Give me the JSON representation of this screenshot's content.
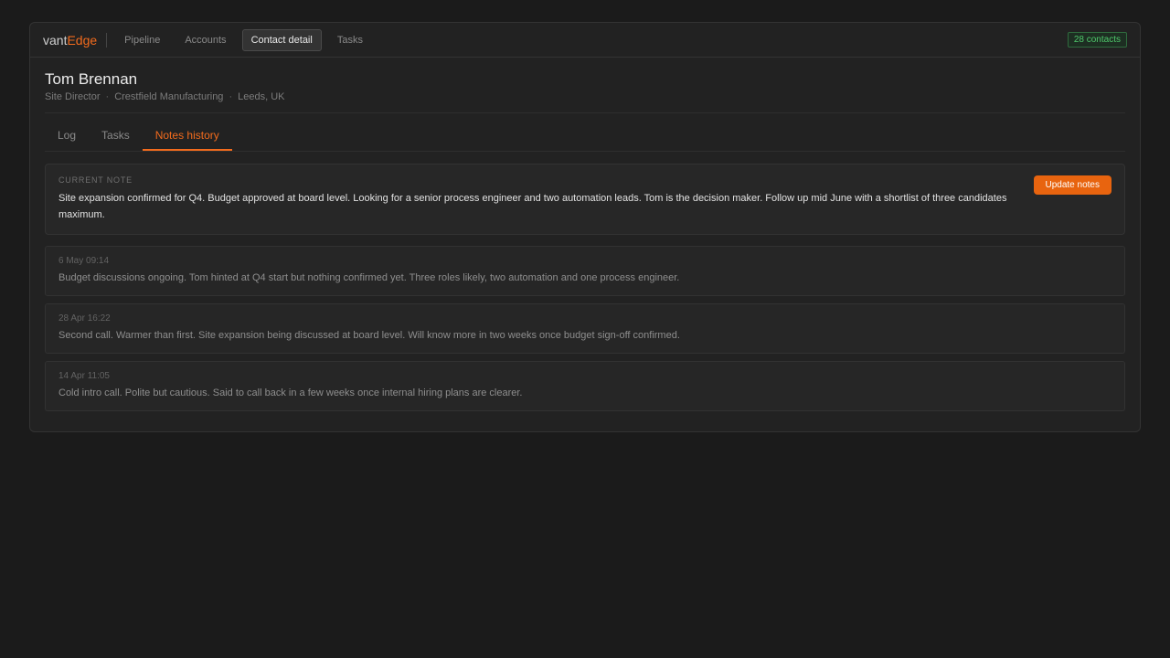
{
  "app": {
    "logo_left": "vant",
    "logo_right": "Edge",
    "nav": [
      {
        "label": "Pipeline"
      },
      {
        "label": "Accounts"
      },
      {
        "label": "Contact detail"
      },
      {
        "label": "Tasks"
      }
    ],
    "active_nav": "Contact detail",
    "contacts_badge": "28 contacts"
  },
  "contact": {
    "name": "Tom Brennan",
    "role": "Site Director",
    "company": "Crestfield Manufacturing",
    "location": "Leeds, UK",
    "separator": "·"
  },
  "tabs": [
    {
      "label": "Log"
    },
    {
      "label": "Tasks"
    },
    {
      "label": "Notes history"
    }
  ],
  "active_tab": "Notes history",
  "current_note": {
    "label": "CURRENT NOTE",
    "text": "Site expansion confirmed for Q4. Budget approved at board level. Looking for a senior process engineer and two automation leads. Tom is the decision maker. Follow up mid June with a shortlist of three candidates maximum.",
    "button_label": "Update notes"
  },
  "history": [
    {
      "date": "6 May 09:14",
      "text": "Budget discussions ongoing. Tom hinted at Q4 start but nothing confirmed yet. Three roles likely, two automation and one process engineer."
    },
    {
      "date": "28 Apr 16:22",
      "text": "Second call. Warmer than first. Site expansion being discussed at board level. Will know more in two weeks once budget sign-off confirmed."
    },
    {
      "date": "14 Apr 11:05",
      "text": "Cold intro call. Polite but cautious. Said to call back in a few weeks once internal hiring plans are clearer."
    }
  ],
  "colors": {
    "accent": "#f26b1d",
    "badge_green": "#4fc76b",
    "background": "#1b1b1b"
  }
}
